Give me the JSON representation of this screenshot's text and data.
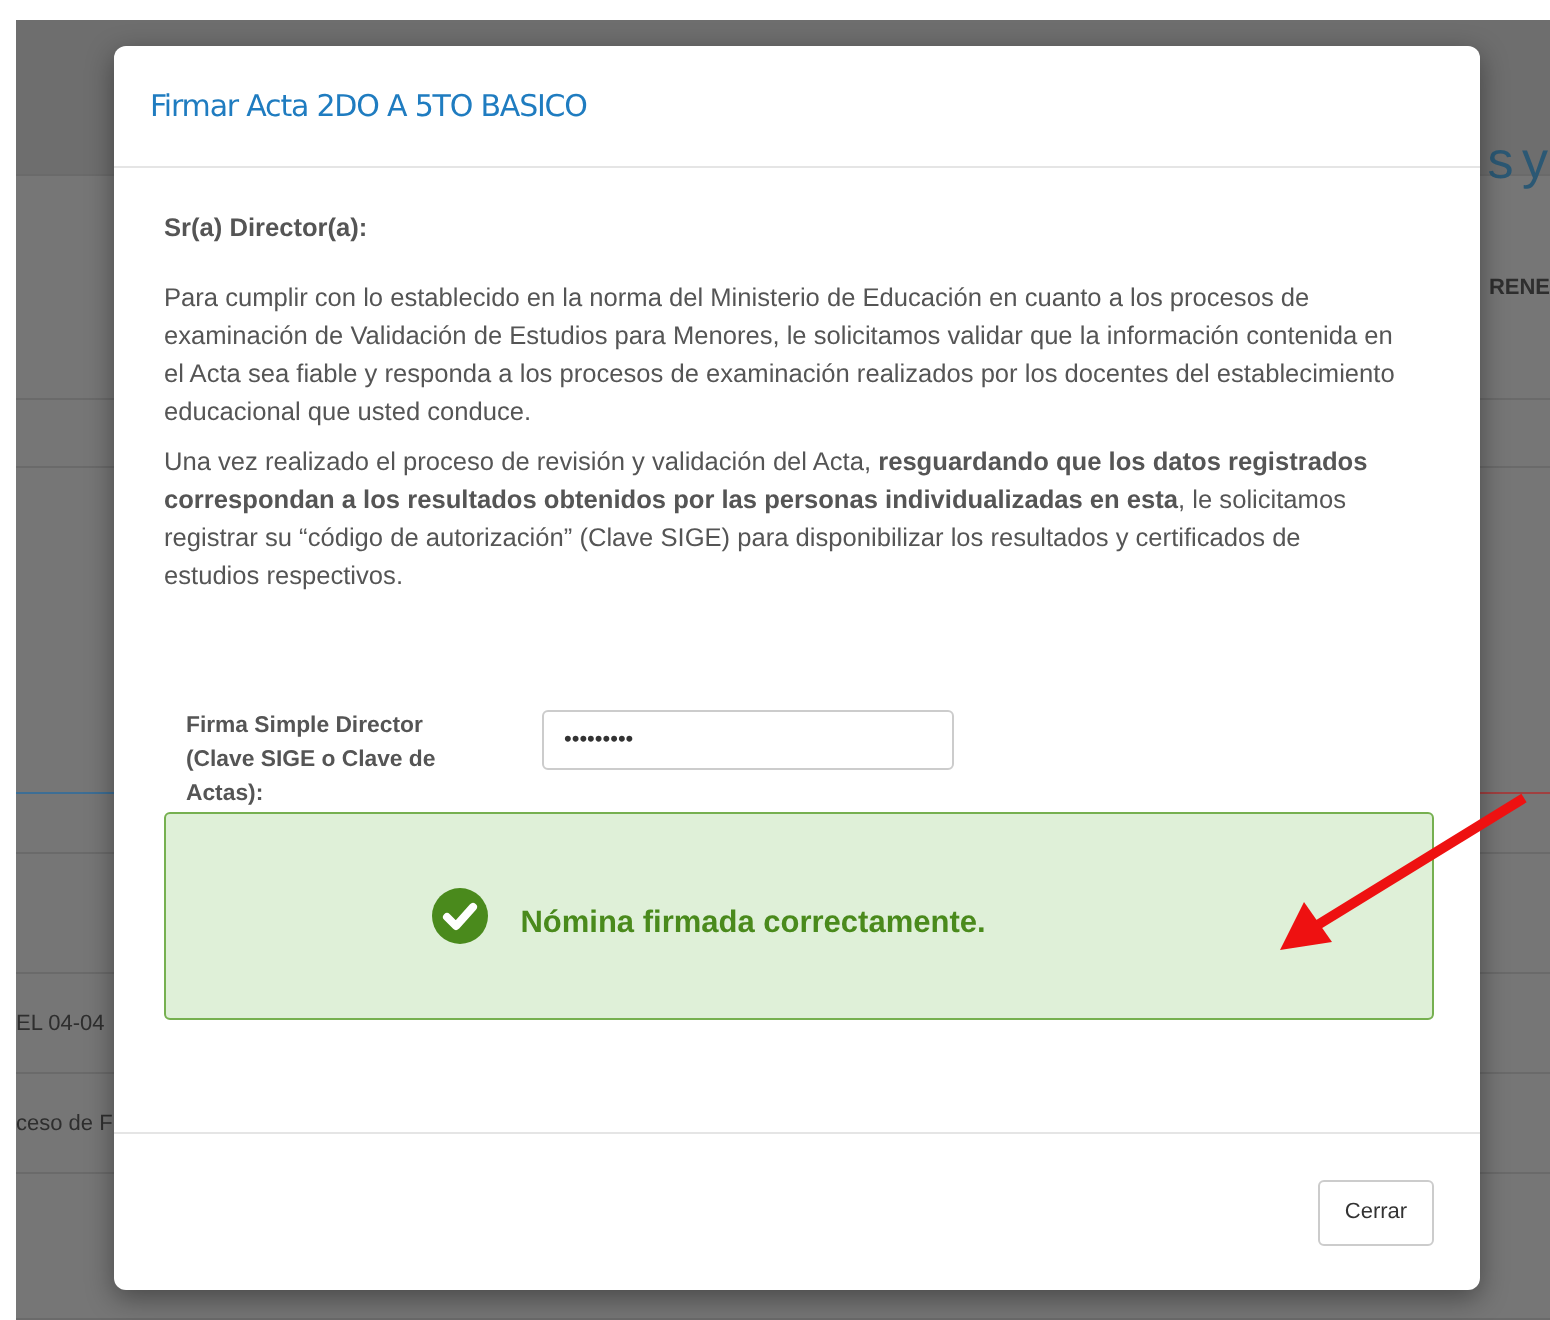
{
  "background_page": {
    "fragments": [
      "s y",
      "RENE",
      "EL 04-04",
      "ceso de F"
    ]
  },
  "dialog": {
    "title": "Firmar Acta 2DO A 5TO BASICO",
    "greeting": "Sr(a) Director(a):",
    "paragraphs": [
      "Para cumplir con lo establecido en la norma del Ministerio de Educación en cuanto a los procesos de examinación de Validación de Estudios para Menores, le solicitamos validar que la información contenida en el Acta sea fiable y responda a los procesos de examinación realizados por los docentes del establecimiento educacional que usted conduce.",
      "Una vez realizado el proceso de revisión y validación del Acta, **resguardando que los datos registrados correspondan a los resultados obtenidos por las personas individualizadas en esta**, le solicitamos registrar su “código de autorización” (Clave SIGE) para disponibilizar los resultados y certificados de estudios respectivos."
    ],
    "field": {
      "label": "Firma Simple Director (Clave SIGE o Clave de Actas):",
      "value": "•••••••••"
    },
    "alert": {
      "message": "Nómina firmada correctamente."
    },
    "buttons": [
      "Cerrar"
    ]
  }
}
